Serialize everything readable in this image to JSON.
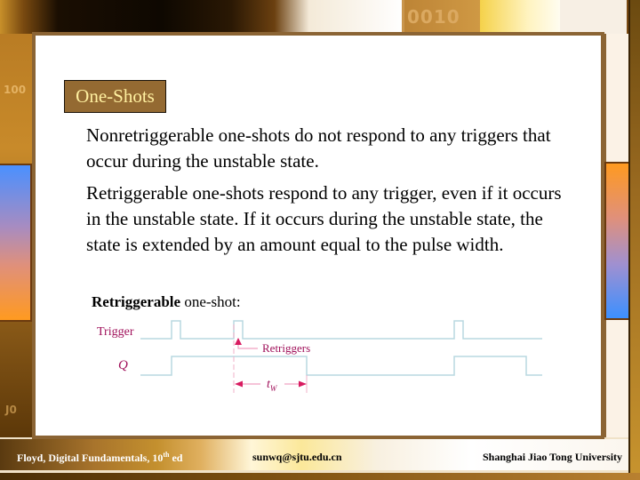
{
  "slide": {
    "title": "One-Shots",
    "paragraphs": [
      "Nonretriggerable one-shots do not respond to any triggers that occur during the unstable state.",
      "Retriggerable one-shots respond to any trigger, even if it occurs in the unstable state. If it occurs during the unstable state, the state is extended by an amount equal to the pulse width."
    ],
    "diagram_caption_bold": "Retriggerable",
    "diagram_caption_rest": " one-shot:"
  },
  "diagram": {
    "signals": [
      {
        "label": "Trigger",
        "pulses_at": [
          1,
          2,
          5
        ],
        "note": "narrow trigger pulses"
      },
      {
        "label": "Q",
        "high_intervals": [
          [
            1,
            3
          ],
          [
            5,
            6
          ]
        ]
      }
    ],
    "annotation_retriggers": "Retriggers",
    "annotation_pulse_width_main": "t",
    "annotation_pulse_width_sub": "W",
    "colors": {
      "waveform": "#b8d8e0",
      "annotation": "#d81b60",
      "label": "#a0105a"
    }
  },
  "background": {
    "top_code": "0010",
    "left_code": "100",
    "left_code_bottom": "J0",
    "accent_gradient": [
      "#4a90ff",
      "#ff9a20"
    ],
    "frame_color": "#8b6434"
  },
  "footer": {
    "left_text": "Floyd, Digital Fundamentals, 10",
    "left_sup": "th",
    "left_suffix": " ed",
    "email": "sunwq@sjtu.edu.cn",
    "institution": "Shanghai Jiao Tong University"
  }
}
